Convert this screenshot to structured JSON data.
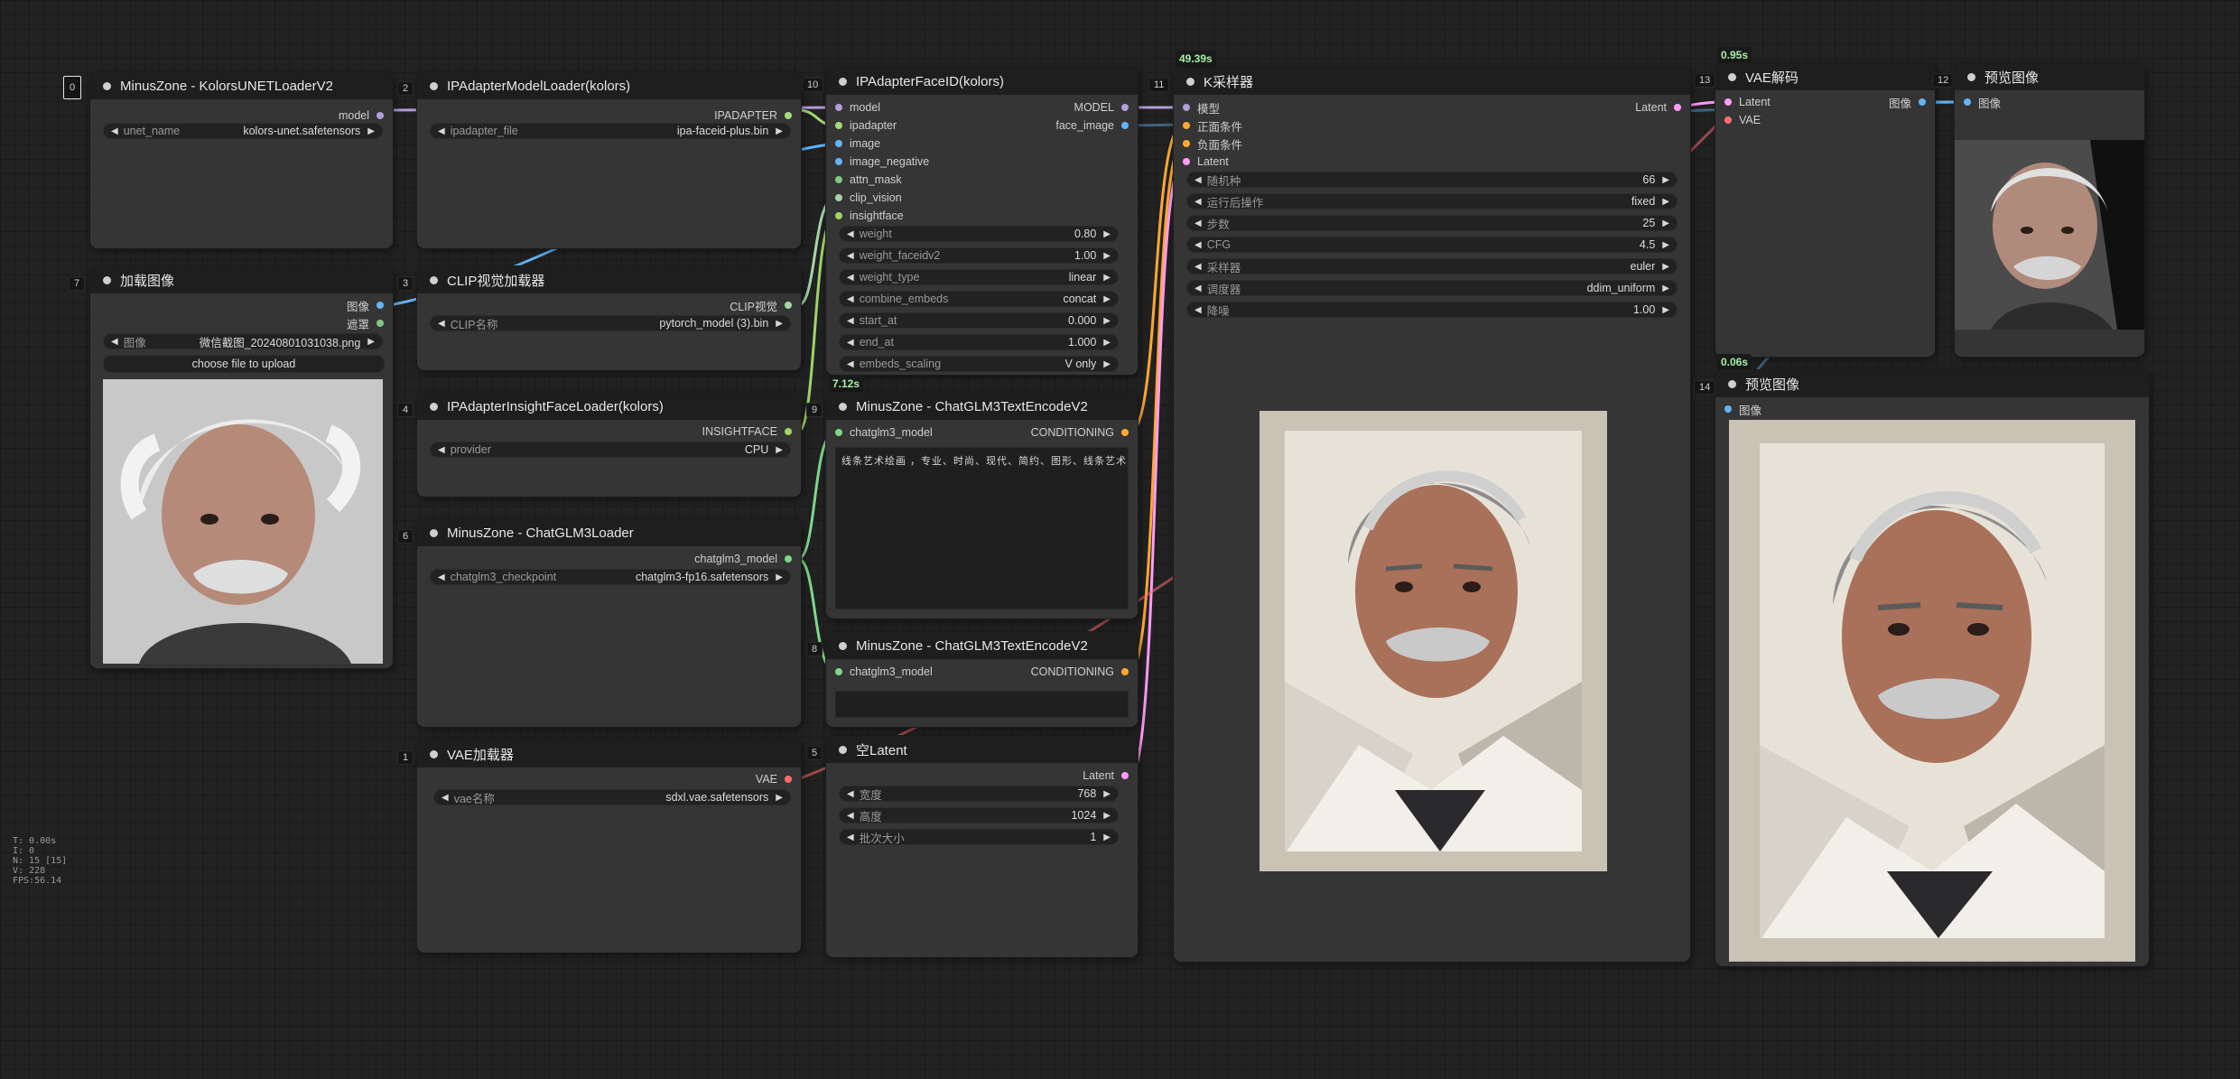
{
  "nodes": {
    "unet": {
      "id": "0",
      "title": "MinusZone - KolorsUNETLoaderV2",
      "output": "model",
      "w_label": "unet_name",
      "w_value": "kolors-unet.safetensors"
    },
    "ipamodel": {
      "id": "2",
      "title": "IPAdapterModelLoader(kolors)",
      "output": "IPADAPTER",
      "w_label": "ipadapter_file",
      "w_value": "ipa-faceid-plus.bin"
    },
    "faceid": {
      "id": "10",
      "title": "IPAdapterFaceID(kolors)",
      "inputs": [
        "model",
        "ipadapter",
        "image",
        "image_negative",
        "attn_mask",
        "clip_vision",
        "insightface"
      ],
      "outputs": [
        "MODEL",
        "face_image"
      ],
      "widgets": [
        {
          "label": "weight",
          "value": "0.80"
        },
        {
          "label": "weight_faceidv2",
          "value": "1.00"
        },
        {
          "label": "weight_type",
          "value": "linear"
        },
        {
          "label": "combine_embeds",
          "value": "concat"
        },
        {
          "label": "start_at",
          "value": "0.000"
        },
        {
          "label": "end_at",
          "value": "1.000"
        },
        {
          "label": "embeds_scaling",
          "value": "V only"
        }
      ]
    },
    "ksampler": {
      "id": "11",
      "title": "K采样器",
      "time": "49.39s",
      "inputs": [
        "模型",
        "正面条件",
        "负面条件",
        "Latent"
      ],
      "widgets": [
        {
          "label": "随机种",
          "value": "66"
        },
        {
          "label": "运行后操作",
          "value": "fixed"
        },
        {
          "label": "步数",
          "value": "25"
        },
        {
          "label": "CFG",
          "value": "4.5"
        },
        {
          "label": "采样器",
          "value": "euler"
        },
        {
          "label": "调度器",
          "value": "ddim_uniform"
        },
        {
          "label": "降噪",
          "value": "1.00"
        }
      ]
    },
    "vaedecode": {
      "id": "13",
      "title": "VAE解码",
      "time": "0.95s",
      "inputs": [
        "Latent",
        "VAE"
      ],
      "output": "图像"
    },
    "preview12": {
      "id": "12",
      "title": "预览图像",
      "input": "图像"
    },
    "preview14": {
      "id": "14",
      "title": "预览图像",
      "time": "0.06s",
      "input": "图像"
    },
    "loadimage": {
      "id": "7",
      "title": "加载图像",
      "outputs": [
        "图像",
        "遮罩"
      ],
      "w_label": "图像",
      "w_value": "微信截图_20240801031038.png",
      "button": "choose file to upload"
    },
    "clipvision": {
      "id": "3",
      "title": "CLIP视觉加载器",
      "output": "CLIP视觉",
      "w_label": "CLIP名称",
      "w_value": "pytorch_model (3).bin"
    },
    "insight": {
      "id": "4",
      "title": "IPAdapterInsightFaceLoader(kolors)",
      "output": "INSIGHTFACE",
      "w_label": "provider",
      "w_value": "CPU"
    },
    "glmloader": {
      "id": "6",
      "title": "MinusZone - ChatGLM3Loader",
      "output": "chatglm3_model",
      "w_label": "chatglm3_checkpoint",
      "w_value": "chatglm3-fp16.safetensors"
    },
    "encode9": {
      "id": "9",
      "title": "MinusZone - ChatGLM3TextEncodeV2",
      "time": "7.12s",
      "input": "chatglm3_model",
      "output": "CONDITIONING",
      "text": "线条艺术绘画 ，专业、时尚、现代、简约、图形、线条艺术、矢量图形"
    },
    "encode8": {
      "id": "8",
      "title": "MinusZone - ChatGLM3TextEncodeV2",
      "input": "chatglm3_model",
      "output": "CONDITIONING",
      "text": ""
    },
    "vaeloader": {
      "id": "1",
      "title": "VAE加载器",
      "output": "VAE",
      "w_label": "vae名称",
      "w_value": "sdxl.vae.safetensors"
    },
    "latent": {
      "id": "5",
      "title": "空Latent",
      "output": "Latent",
      "widgets": [
        {
          "label": "宽度",
          "value": "768"
        },
        {
          "label": "高度",
          "value": "1024"
        },
        {
          "label": "批次大小",
          "value": "1"
        }
      ]
    }
  },
  "stats": [
    "T: 0.00s",
    "I: 0",
    "N: 15 [15]",
    "V: 228",
    "FPS:56.14"
  ],
  "colors": {
    "background": "#222222",
    "node_body": "#353535",
    "node_header": "#1e1e1e",
    "model": "#b39ddb",
    "image": "#64b5f6",
    "conditioning": "#ffa931",
    "latent": "#ff9cf9",
    "vae": "#ff6e6e",
    "clip_vision": "#a5d6a7",
    "chatglm": "#7fd88a"
  },
  "icons": {
    "arrow_left": "◀",
    "arrow_right": "▶"
  }
}
